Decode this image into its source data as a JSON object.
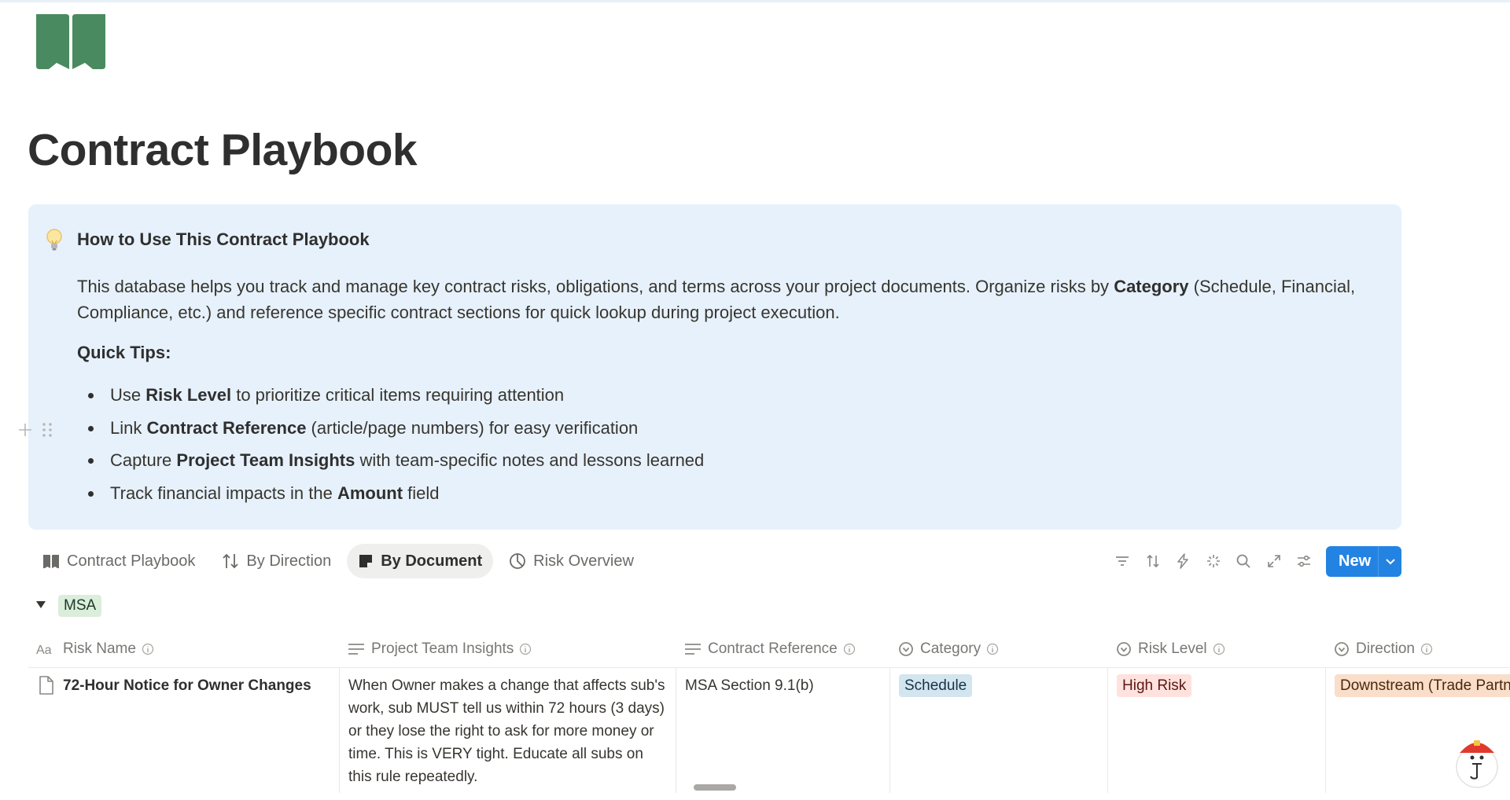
{
  "page": {
    "title": "Contract Playbook",
    "icon": "open-book-icon",
    "accent_color": "#4a8a60"
  },
  "callout": {
    "icon": "lightbulb-icon",
    "title": "How to Use This Contract Playbook",
    "intro_before": "This database helps you track and manage key contract risks, obligations, and terms across your project documents. Organize risks by ",
    "intro_bold": "Category",
    "intro_after": " (Schedule, Financial, Compliance, etc.) and reference specific contract sections for quick lookup during project execution.",
    "tips_heading": "Quick Tips:",
    "tips": [
      {
        "before": "Use ",
        "bold": "Risk Level",
        "after": " to prioritize critical items requiring attention"
      },
      {
        "before": "Link ",
        "bold": "Contract Reference",
        "after": " (article/page numbers) for easy verification"
      },
      {
        "before": "Capture ",
        "bold": "Project Team Insights",
        "after": " with team-specific notes and lessons learned"
      },
      {
        "before": "Track financial impacts in the ",
        "bold": "Amount",
        "after": " field"
      }
    ]
  },
  "views": [
    {
      "label": "Contract Playbook",
      "icon": "book-icon",
      "active": false
    },
    {
      "label": "By Direction",
      "icon": "sort-arrows-icon",
      "active": false
    },
    {
      "label": "By Document",
      "icon": "document-icon",
      "active": true
    },
    {
      "label": "Risk Overview",
      "icon": "pie-chart-icon",
      "active": false
    }
  ],
  "toolbar": {
    "icons": [
      "filter-icon",
      "sort-icon",
      "automation-icon",
      "ai-sparkle-icon",
      "search-icon",
      "expand-icon",
      "settings-icon"
    ],
    "new_label": "New",
    "new_color": "#2383e2"
  },
  "group": {
    "label": "MSA",
    "color": "#dbeddb"
  },
  "columns": [
    {
      "label": "Risk Name",
      "icon": "title-aa-icon"
    },
    {
      "label": "Project Team Insights",
      "icon": "text-lines-icon"
    },
    {
      "label": "Contract Reference",
      "icon": "text-lines-icon"
    },
    {
      "label": "Category",
      "icon": "select-icon"
    },
    {
      "label": "Risk Level",
      "icon": "select-icon"
    },
    {
      "label": "Direction",
      "icon": "select-icon"
    }
  ],
  "rows": [
    {
      "risk_name": "72-Hour Notice for Owner Changes",
      "insights": "When Owner makes a change that affects sub's work, sub MUST tell us within 72 hours (3 days) or they lose the right to ask for more money or time. This is VERY tight. Educate all subs on this rule repeatedly.",
      "contract_reference": "MSA Section 9.1(b)",
      "category": "Schedule",
      "category_bg": "#d3e5ef",
      "category_fg": "#183347",
      "risk_level": "High Risk",
      "risk_level_bg": "#ffe2dd",
      "risk_level_fg": "#5d1715",
      "direction": "Downstream (Trade Partner)",
      "direction_bg": "#fadec9",
      "direction_fg": "#49290e"
    }
  ]
}
